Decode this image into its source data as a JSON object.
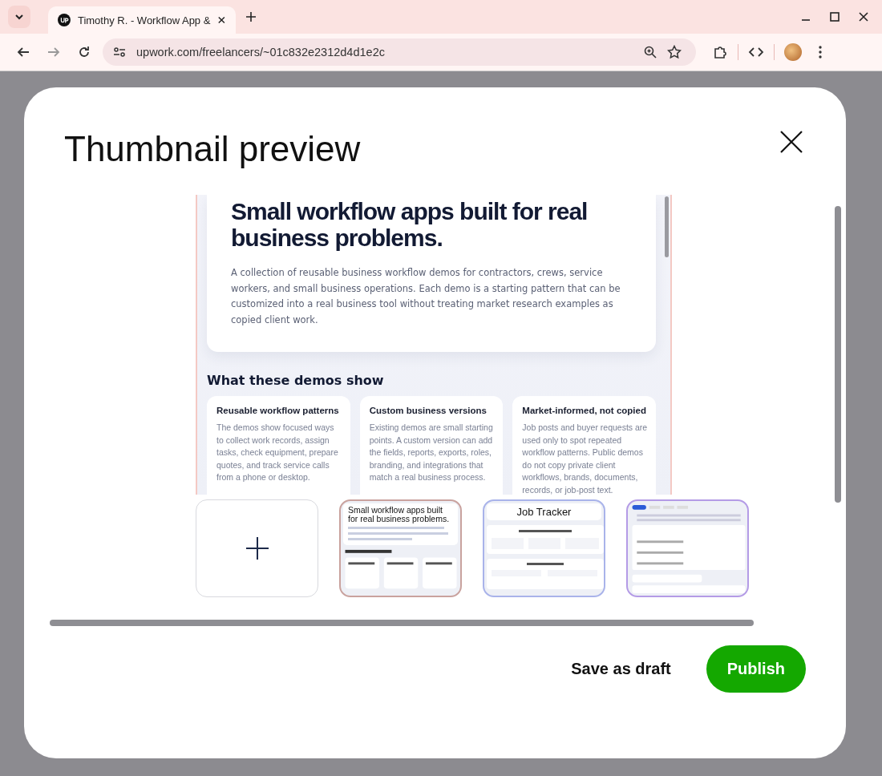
{
  "browser": {
    "tab_title": "Timothy R. - Workflow App &",
    "url": "upwork.com/freelancers/~01c832e2312d4d1e2c"
  },
  "modal": {
    "title": "Thumbnail preview",
    "preview": {
      "heading": "Small workflow apps built for real business problems.",
      "intro": "A collection of reusable business workflow demos for contractors, crews, service workers, and small business operations. Each demo is a starting pattern that can be customized into a real business tool without treating market research examples as copied client work.",
      "section_title": "What these demos show",
      "cards": [
        {
          "title": "Reusable workflow patterns",
          "body": "The demos show focused ways to collect work records, assign tasks, check equipment, prepare quotes, and track service calls from a phone or desktop."
        },
        {
          "title": "Custom business versions",
          "body": "Existing demos are small starting points. A custom version can add the fields, reports, exports, roles, branding, and integrations that match a real business process."
        },
        {
          "title": "Market-informed, not copied",
          "body": "Job posts and buyer requests are used only to spot repeated workflow patterns. Public demos do not copy private client workflows, brands, documents, records, or job-post text."
        }
      ]
    },
    "thumbnails": [
      {
        "kind": "add"
      },
      {
        "kind": "page",
        "title": "Small workflow apps built for real business problems."
      },
      {
        "kind": "tracker",
        "title": "Job Tracker"
      },
      {
        "kind": "form"
      }
    ],
    "buttons": [
      {
        "kind": "secondary",
        "label": "Save as draft"
      },
      {
        "kind": "primary",
        "label": "Publish"
      }
    ]
  }
}
